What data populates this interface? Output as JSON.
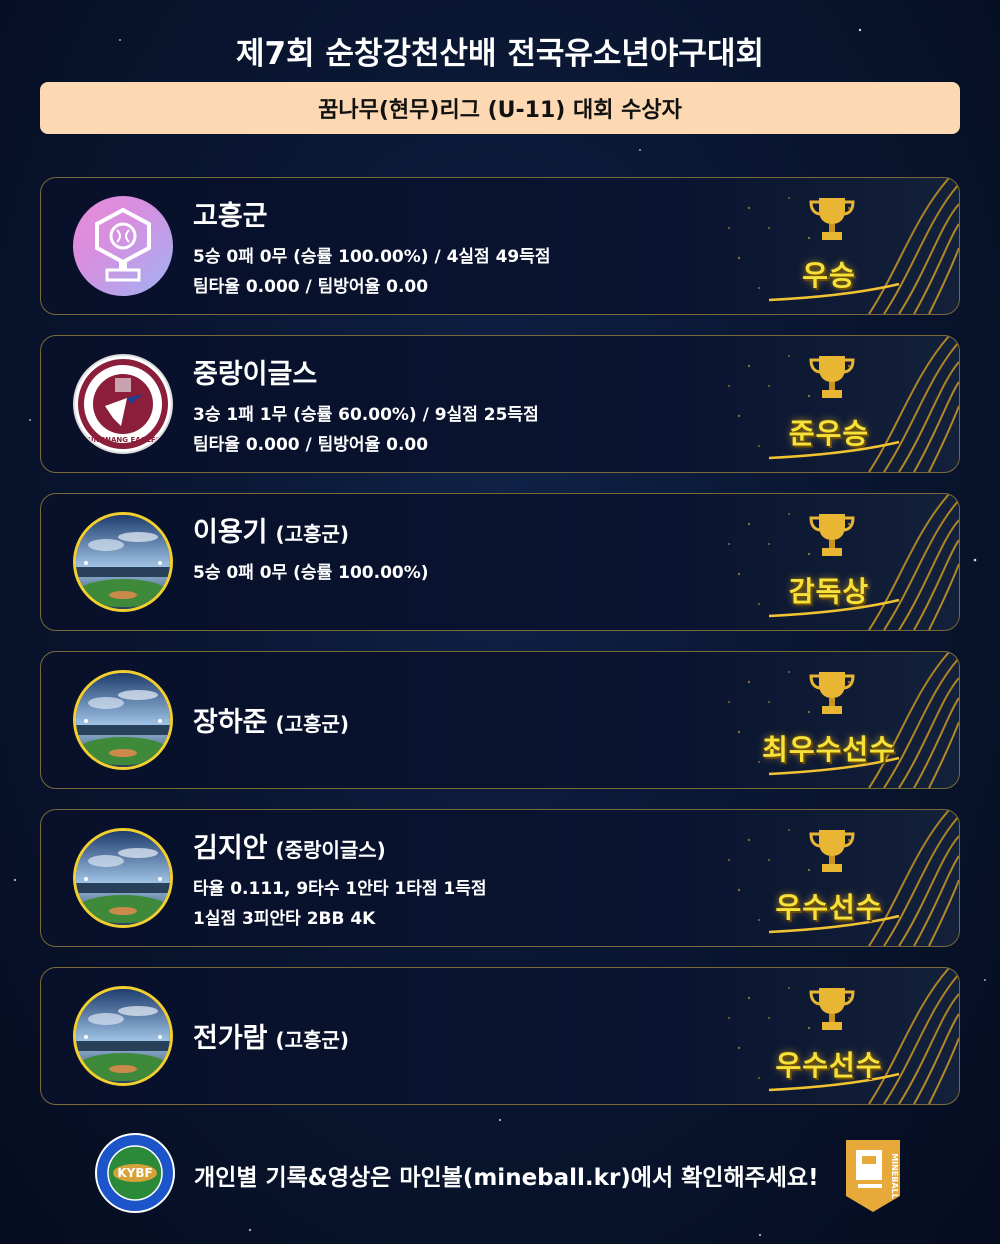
{
  "header": {
    "title": "제7회 순창강천산배 전국유소년야구대회",
    "subtitle": "꿈나무(현무)리그 (U-11) 대회 수상자"
  },
  "awards": [
    {
      "name": "고흥군",
      "team": "",
      "line1": "5승 0패 0무 (승률 100.00%) / 4실점 49득점",
      "line2": "팀타율 0.000 / 팀방어율 0.00",
      "award": "우승",
      "avatar": "trophy-icon"
    },
    {
      "name": "중랑이글스",
      "team": "",
      "line1": "3승 1패 1무 (승률 60.00%) / 9실점 25득점",
      "line2": "팀타율 0.000 / 팀방어율 0.00",
      "award": "준우승",
      "avatar": "team-logo",
      "logo_text": "JUNGNANG EAGLES"
    },
    {
      "name": "이용기",
      "team": "(고흥군)",
      "line1": "5승 0패 0무 (승률 100.00%)",
      "line2": "",
      "award": "감독상",
      "avatar": "stadium"
    },
    {
      "name": "장하준",
      "team": "(고흥군)",
      "line1": "",
      "line2": "",
      "award": "최우수선수",
      "avatar": "stadium"
    },
    {
      "name": "김지안",
      "team": "(중랑이글스)",
      "line1": "타율 0.111, 9타수 1안타 1타점 1득점",
      "line2": "1실점 3피안타 2BB 4K",
      "award": "우수선수",
      "avatar": "stadium"
    },
    {
      "name": "전가람",
      "team": "(고흥군)",
      "line1": "",
      "line2": "",
      "award": "우수선수",
      "avatar": "stadium"
    }
  ],
  "footer": {
    "text": "개인별 기록&영상은 마인볼(mineball.kr)에서 확인해주세요!",
    "kybf_logo_text": "KYBF",
    "mineball_logo_text": "MINEBALL"
  },
  "colors": {
    "background": "#0a1733",
    "subtitle_bar": "#fcd8b3",
    "award_text": "#f6e23a",
    "card_border": "#7a6a3a"
  }
}
